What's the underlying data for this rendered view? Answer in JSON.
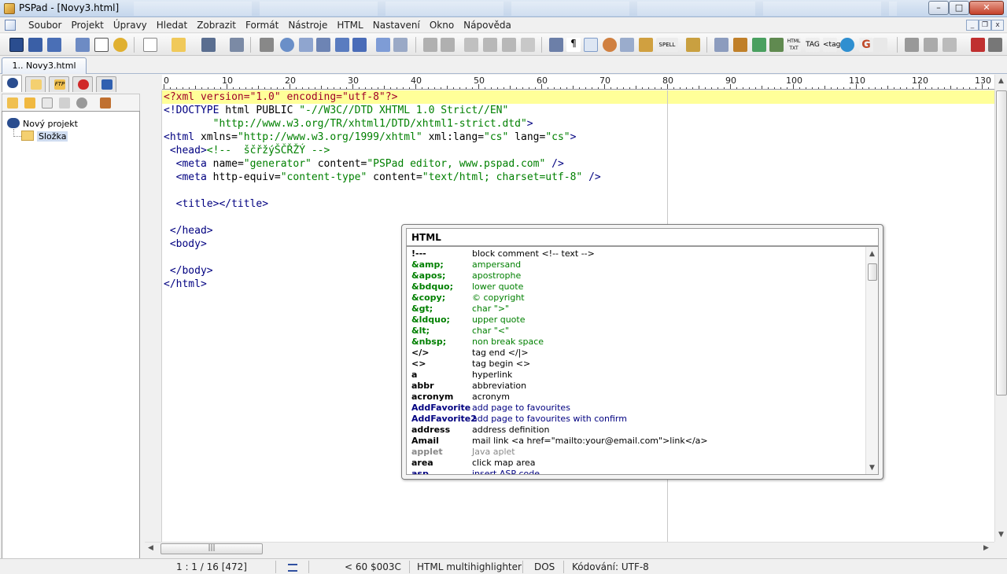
{
  "window": {
    "title": "PSPad - [Novy3.html]"
  },
  "menu": [
    "Soubor",
    "Projekt",
    "Úpravy",
    "Hledat",
    "Zobrazit",
    "Formát",
    "Nástroje",
    "HTML",
    "Nastavení",
    "Okno",
    "Nápověda"
  ],
  "file_tab": {
    "label": "1.. Novy3.html"
  },
  "project_tree": {
    "project": "Nový projekt",
    "folder": "Složka"
  },
  "editor": {
    "ruler_labels": [
      "0",
      "10",
      "20",
      "30",
      "40",
      "50",
      "60",
      "70",
      "80",
      "90",
      "100",
      "110",
      "120",
      "130"
    ],
    "lines": [
      "<?xml version=\"1.0\" encoding=\"utf-8\"?>",
      "<!DOCTYPE html PUBLIC \"-//W3C//DTD XHTML 1.0 Strict//EN\"",
      "        \"http://www.w3.org/TR/xhtml1/DTD/xhtml1-strict.dtd\">",
      "<html xmlns=\"http://www.w3.org/1999/xhtml\" xml:lang=\"cs\" lang=\"cs\">",
      " <head><!--  ščřžýŠČŘŽÝ -->",
      "  <meta name=\"generator\" content=\"PSPad editor, www.pspad.com\" />",
      "  <meta http-equiv=\"content-type\" content=\"text/html; charset=utf-8\" />",
      "",
      "  <title></title>",
      "",
      " </head>",
      " <body>",
      "",
      " </body>",
      "</html>"
    ]
  },
  "clip_window": {
    "title": "HTML",
    "items": [
      {
        "key": "!---",
        "desc": "block comment <!-- text -->",
        "color": "black"
      },
      {
        "key": "&amp;",
        "desc": "ampersand",
        "color": "green"
      },
      {
        "key": "&apos;",
        "desc": "apostrophe",
        "color": "green"
      },
      {
        "key": "&bdquo;",
        "desc": "lower quote",
        "color": "green"
      },
      {
        "key": "&copy;",
        "desc": "© copyright",
        "color": "green"
      },
      {
        "key": "&gt;",
        "desc": "char \">\"",
        "color": "green"
      },
      {
        "key": "&ldquo;",
        "desc": "upper quote",
        "color": "green"
      },
      {
        "key": "&lt;",
        "desc": "char \"<\"",
        "color": "green"
      },
      {
        "key": "&nbsp;",
        "desc": "non break space",
        "color": "green"
      },
      {
        "key": "</>",
        "desc": "tag end </|>",
        "color": "black"
      },
      {
        "key": "<>",
        "desc": "tag begin <>",
        "color": "black"
      },
      {
        "key": "a",
        "desc": "hyperlink",
        "color": "black"
      },
      {
        "key": "abbr",
        "desc": "abbreviation",
        "color": "black"
      },
      {
        "key": "acronym",
        "desc": "acronym",
        "color": "black"
      },
      {
        "key": "AddFavorite",
        "desc": "add page to favourites",
        "color": "blue"
      },
      {
        "key": "AddFavorite2",
        "desc": "add page to favourites with confirm",
        "color": "blue"
      },
      {
        "key": "address",
        "desc": "address definition",
        "color": "black"
      },
      {
        "key": "Amail",
        "desc": "mail link <a href=\"mailto:your@email.com\">link</a>",
        "color": "black"
      },
      {
        "key": "applet",
        "desc": "Java aplet",
        "color": "gray"
      },
      {
        "key": "area",
        "desc": "click map area",
        "color": "black"
      },
      {
        "key": "asp",
        "desc": "insert ASP code",
        "color": "blue"
      }
    ]
  },
  "status": {
    "position": "1 : 1 / 16  [472]",
    "char": "<   60  $003C",
    "highlighter": "HTML multihighlighter",
    "lineend": "DOS",
    "encoding": "Kódování: UTF-8"
  },
  "colors": {
    "current_line": "#ffff99",
    "tag": "#000080",
    "value": "#008000"
  }
}
